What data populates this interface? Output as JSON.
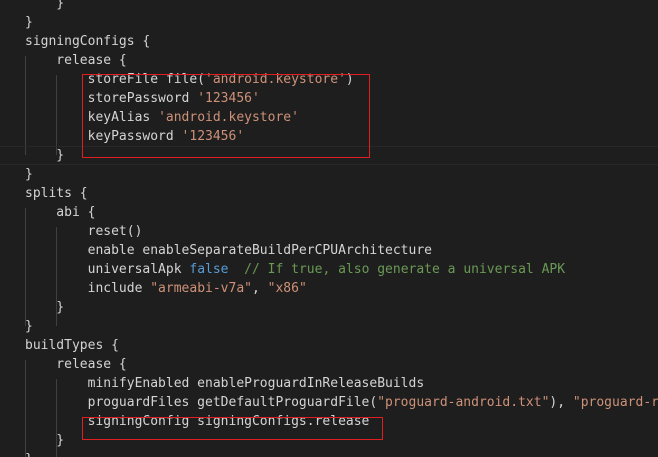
{
  "editor": {
    "lines": [
      [
        {
          "t": "    }",
          "c": "plain"
        }
      ],
      [
        {
          "t": "}",
          "c": "plain"
        }
      ],
      [
        {
          "t": "signingConfigs {",
          "c": "plain"
        }
      ],
      [
        {
          "t": "    release {",
          "c": "plain"
        }
      ],
      [
        {
          "t": "        storeFile file(",
          "c": "plain"
        },
        {
          "t": "'android.keystore'",
          "c": "str"
        },
        {
          "t": ")",
          "c": "plain"
        }
      ],
      [
        {
          "t": "        storePassword ",
          "c": "plain"
        },
        {
          "t": "'123456'",
          "c": "str"
        }
      ],
      [
        {
          "t": "        keyAlias ",
          "c": "plain"
        },
        {
          "t": "'android.keystore'",
          "c": "str"
        }
      ],
      [
        {
          "t": "        keyPassword ",
          "c": "plain"
        },
        {
          "t": "'123456'",
          "c": "str"
        }
      ],
      [
        {
          "t": "    }",
          "c": "plain"
        }
      ],
      [
        {
          "t": "}",
          "c": "plain"
        }
      ],
      [
        {
          "t": "splits {",
          "c": "plain"
        }
      ],
      [
        {
          "t": "    abi {",
          "c": "plain"
        }
      ],
      [
        {
          "t": "        reset()",
          "c": "plain"
        }
      ],
      [
        {
          "t": "        enable enableSeparateBuildPerCPUArchitecture",
          "c": "plain"
        }
      ],
      [
        {
          "t": "        universalApk ",
          "c": "plain"
        },
        {
          "t": "false",
          "c": "kw"
        },
        {
          "t": "  ",
          "c": "plain"
        },
        {
          "t": "// If true, also generate a universal APK",
          "c": "cmt"
        }
      ],
      [
        {
          "t": "        include ",
          "c": "plain"
        },
        {
          "t": "\"armeabi-v7a\"",
          "c": "str"
        },
        {
          "t": ", ",
          "c": "plain"
        },
        {
          "t": "\"x86\"",
          "c": "str"
        }
      ],
      [
        {
          "t": "    }",
          "c": "plain"
        }
      ],
      [
        {
          "t": "}",
          "c": "plain"
        }
      ],
      [
        {
          "t": "buildTypes {",
          "c": "plain"
        }
      ],
      [
        {
          "t": "    release {",
          "c": "plain"
        }
      ],
      [
        {
          "t": "        minifyEnabled enableProguardInReleaseBuilds",
          "c": "plain"
        }
      ],
      [
        {
          "t": "        proguardFiles getDefaultProguardFile(",
          "c": "plain"
        },
        {
          "t": "\"proguard-android.txt\"",
          "c": "str"
        },
        {
          "t": "), ",
          "c": "plain"
        },
        {
          "t": "\"proguard-rules.pro\"",
          "c": "str"
        }
      ],
      [
        {
          "t": "        signingConfig signingConfigs.release",
          "c": "plain"
        }
      ],
      [
        {
          "t": "    }",
          "c": "plain"
        }
      ],
      [
        {
          "t": "}",
          "c": "plain"
        }
      ]
    ]
  },
  "colors": {
    "background": "#1e1e1e",
    "text": "#d4d4d4",
    "string": "#ce9178",
    "keyword": "#569cd6",
    "comment": "#6a9955",
    "highlight_box": "#e02020"
  }
}
